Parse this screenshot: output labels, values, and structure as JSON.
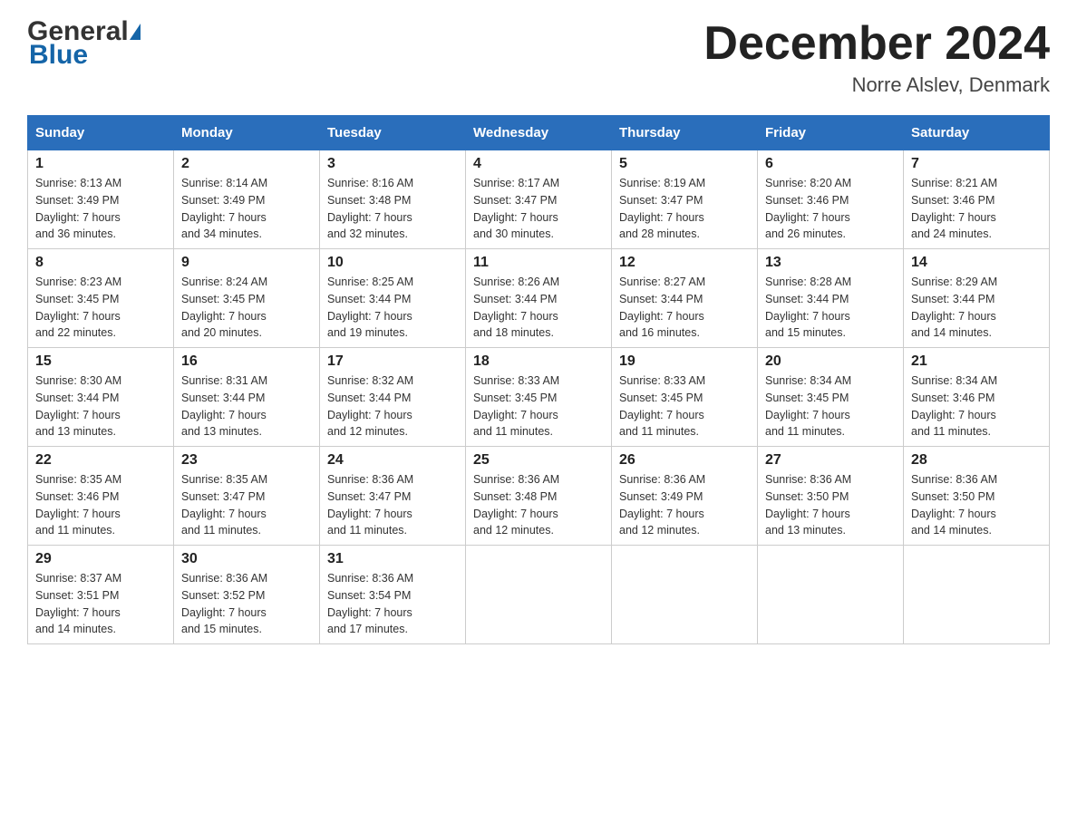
{
  "header": {
    "month_title": "December 2024",
    "location": "Norre Alslev, Denmark",
    "logo_general": "General",
    "logo_blue": "Blue"
  },
  "days_of_week": [
    "Sunday",
    "Monday",
    "Tuesday",
    "Wednesday",
    "Thursday",
    "Friday",
    "Saturday"
  ],
  "weeks": [
    [
      {
        "date": "1",
        "sunrise": "8:13 AM",
        "sunset": "3:49 PM",
        "daylight": "7 hours and 36 minutes."
      },
      {
        "date": "2",
        "sunrise": "8:14 AM",
        "sunset": "3:49 PM",
        "daylight": "7 hours and 34 minutes."
      },
      {
        "date": "3",
        "sunrise": "8:16 AM",
        "sunset": "3:48 PM",
        "daylight": "7 hours and 32 minutes."
      },
      {
        "date": "4",
        "sunrise": "8:17 AM",
        "sunset": "3:47 PM",
        "daylight": "7 hours and 30 minutes."
      },
      {
        "date": "5",
        "sunrise": "8:19 AM",
        "sunset": "3:47 PM",
        "daylight": "7 hours and 28 minutes."
      },
      {
        "date": "6",
        "sunrise": "8:20 AM",
        "sunset": "3:46 PM",
        "daylight": "7 hours and 26 minutes."
      },
      {
        "date": "7",
        "sunrise": "8:21 AM",
        "sunset": "3:46 PM",
        "daylight": "7 hours and 24 minutes."
      }
    ],
    [
      {
        "date": "8",
        "sunrise": "8:23 AM",
        "sunset": "3:45 PM",
        "daylight": "7 hours and 22 minutes."
      },
      {
        "date": "9",
        "sunrise": "8:24 AM",
        "sunset": "3:45 PM",
        "daylight": "7 hours and 20 minutes."
      },
      {
        "date": "10",
        "sunrise": "8:25 AM",
        "sunset": "3:44 PM",
        "daylight": "7 hours and 19 minutes."
      },
      {
        "date": "11",
        "sunrise": "8:26 AM",
        "sunset": "3:44 PM",
        "daylight": "7 hours and 18 minutes."
      },
      {
        "date": "12",
        "sunrise": "8:27 AM",
        "sunset": "3:44 PM",
        "daylight": "7 hours and 16 minutes."
      },
      {
        "date": "13",
        "sunrise": "8:28 AM",
        "sunset": "3:44 PM",
        "daylight": "7 hours and 15 minutes."
      },
      {
        "date": "14",
        "sunrise": "8:29 AM",
        "sunset": "3:44 PM",
        "daylight": "7 hours and 14 minutes."
      }
    ],
    [
      {
        "date": "15",
        "sunrise": "8:30 AM",
        "sunset": "3:44 PM",
        "daylight": "7 hours and 13 minutes."
      },
      {
        "date": "16",
        "sunrise": "8:31 AM",
        "sunset": "3:44 PM",
        "daylight": "7 hours and 13 minutes."
      },
      {
        "date": "17",
        "sunrise": "8:32 AM",
        "sunset": "3:44 PM",
        "daylight": "7 hours and 12 minutes."
      },
      {
        "date": "18",
        "sunrise": "8:33 AM",
        "sunset": "3:45 PM",
        "daylight": "7 hours and 11 minutes."
      },
      {
        "date": "19",
        "sunrise": "8:33 AM",
        "sunset": "3:45 PM",
        "daylight": "7 hours and 11 minutes."
      },
      {
        "date": "20",
        "sunrise": "8:34 AM",
        "sunset": "3:45 PM",
        "daylight": "7 hours and 11 minutes."
      },
      {
        "date": "21",
        "sunrise": "8:34 AM",
        "sunset": "3:46 PM",
        "daylight": "7 hours and 11 minutes."
      }
    ],
    [
      {
        "date": "22",
        "sunrise": "8:35 AM",
        "sunset": "3:46 PM",
        "daylight": "7 hours and 11 minutes."
      },
      {
        "date": "23",
        "sunrise": "8:35 AM",
        "sunset": "3:47 PM",
        "daylight": "7 hours and 11 minutes."
      },
      {
        "date": "24",
        "sunrise": "8:36 AM",
        "sunset": "3:47 PM",
        "daylight": "7 hours and 11 minutes."
      },
      {
        "date": "25",
        "sunrise": "8:36 AM",
        "sunset": "3:48 PM",
        "daylight": "7 hours and 12 minutes."
      },
      {
        "date": "26",
        "sunrise": "8:36 AM",
        "sunset": "3:49 PM",
        "daylight": "7 hours and 12 minutes."
      },
      {
        "date": "27",
        "sunrise": "8:36 AM",
        "sunset": "3:50 PM",
        "daylight": "7 hours and 13 minutes."
      },
      {
        "date": "28",
        "sunrise": "8:36 AM",
        "sunset": "3:50 PM",
        "daylight": "7 hours and 14 minutes."
      }
    ],
    [
      {
        "date": "29",
        "sunrise": "8:37 AM",
        "sunset": "3:51 PM",
        "daylight": "7 hours and 14 minutes."
      },
      {
        "date": "30",
        "sunrise": "8:36 AM",
        "sunset": "3:52 PM",
        "daylight": "7 hours and 15 minutes."
      },
      {
        "date": "31",
        "sunrise": "8:36 AM",
        "sunset": "3:54 PM",
        "daylight": "7 hours and 17 minutes."
      },
      null,
      null,
      null,
      null
    ]
  ],
  "labels": {
    "sunrise": "Sunrise:",
    "sunset": "Sunset:",
    "daylight": "Daylight:"
  }
}
